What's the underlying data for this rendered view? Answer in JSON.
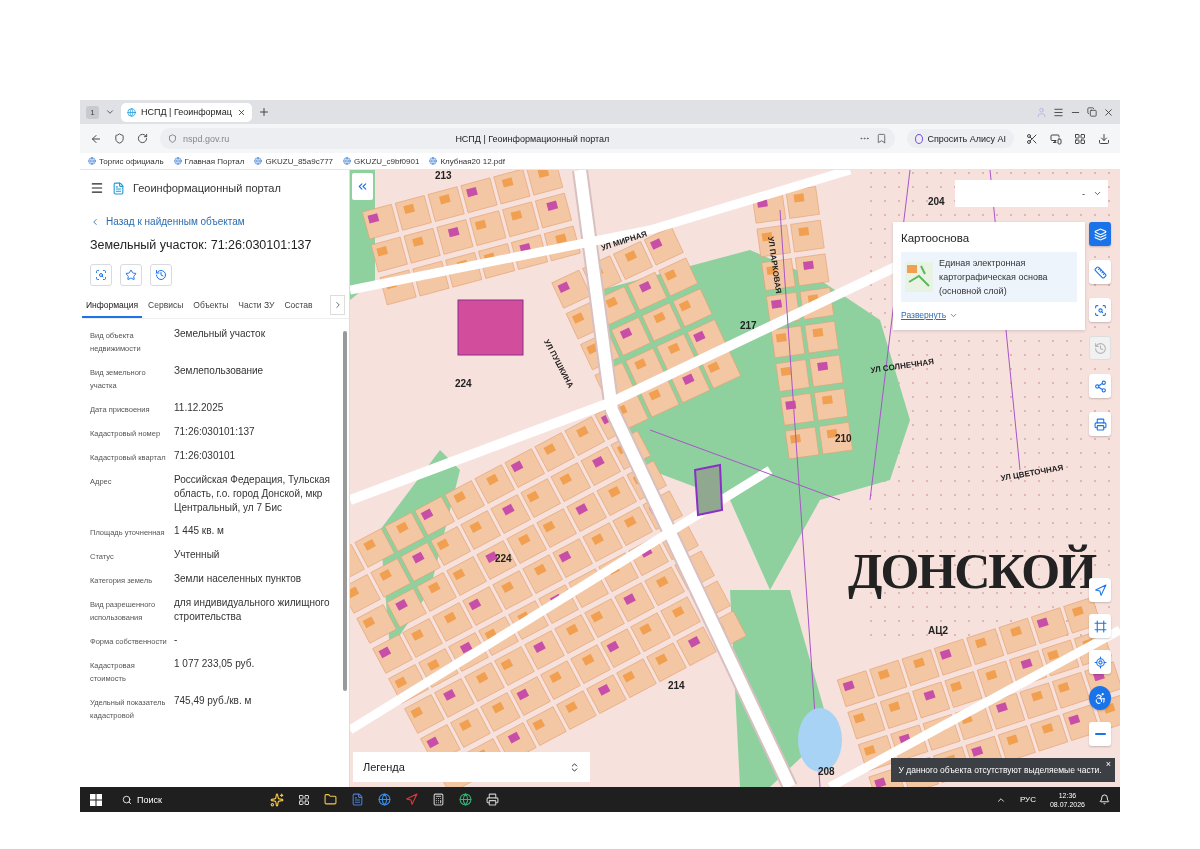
{
  "browser": {
    "tab_counter": "1",
    "tab_title": "НСПД | Геоинформац",
    "url": "nspd.gov.ru",
    "page_title": "НСПД | Геоинформационный портал",
    "ask_button": "Спросить Алису AI",
    "bookmarks": [
      "Торгис официаль",
      "Главная Портал",
      "GKUZU_85a9c777",
      "GKUZU_c9bf0901",
      "Клубная20 12.pdf"
    ]
  },
  "sidebar": {
    "app_title": "Геоинформационный портал",
    "back_link": "Назад к найденным объектам",
    "heading": "Земельный участок: 71:26:030101:137",
    "tabs": [
      {
        "label": "Информация",
        "selected": true
      },
      {
        "label": "Сервисы",
        "selected": false
      },
      {
        "label": "Объекты",
        "selected": false
      },
      {
        "label": "Части ЗУ",
        "selected": false
      },
      {
        "label": "Состав",
        "selected": false
      }
    ],
    "properties": [
      {
        "label": "Вид объекта недвижимости",
        "value": "Земельный участок"
      },
      {
        "label": "Вид земельного участка",
        "value": "Землепользование"
      },
      {
        "label": "Дата присвоения",
        "value": "11.12.2025"
      },
      {
        "label": "Кадастровый номер",
        "value": "71:26:030101:137"
      },
      {
        "label": "Кадастровый квартал",
        "value": "71:26:030101"
      },
      {
        "label": "Адрес",
        "value": "Российская Федерация, Тульская область, г.о. город Донской, мкр Центральный, ул 7 Бис"
      },
      {
        "label": "Площадь уточненная",
        "value": "1 445 кв. м"
      },
      {
        "label": "Статус",
        "value": "Учтенный"
      },
      {
        "label": "Категория земель",
        "value": "Земли населенных пунктов"
      },
      {
        "label": "Вид разрешенного использования",
        "value": "для индивидуального жилищного строительства"
      },
      {
        "label": "Форма собственности",
        "value": "-"
      },
      {
        "label": "Кадастровая стоимость",
        "value": "1 077 233,05 руб."
      },
      {
        "label": "Удельный показатель кадастровой",
        "value": "745,49 руб./кв. м"
      }
    ]
  },
  "map": {
    "layer_select": {
      "value": "-"
    },
    "basemap": {
      "title": "Картооснова",
      "layer": "Единая электронная картографическая основа (основной слой)",
      "expand_link": "Развернуть"
    },
    "tools": [
      {
        "kind": "layers",
        "selected": true,
        "disabled": false
      },
      {
        "kind": "ruler",
        "selected": false,
        "disabled": false
      },
      {
        "kind": "area-search",
        "selected": false,
        "disabled": false
      },
      {
        "kind": "history",
        "selected": false,
        "disabled": true
      },
      {
        "kind": "share",
        "selected": false,
        "disabled": false
      },
      {
        "kind": "print",
        "selected": false,
        "disabled": false
      }
    ],
    "nav_tools": [
      {
        "kind": "navigate"
      },
      {
        "kind": "frame"
      },
      {
        "kind": "locate"
      },
      {
        "kind": "accessibility"
      },
      {
        "kind": "zoom-out"
      }
    ],
    "labels": [
      {
        "kind": "number",
        "text": "213"
      },
      {
        "kind": "number",
        "text": "204"
      },
      {
        "kind": "street",
        "text": "УЛ МИРНАЯ"
      },
      {
        "kind": "street",
        "text": "УЛ ПАРКОВАЯ"
      },
      {
        "kind": "number",
        "text": "217"
      },
      {
        "kind": "number",
        "text": "224"
      },
      {
        "kind": "street",
        "text": "УЛ ПУШКИНА"
      },
      {
        "kind": "street",
        "text": "УЛ СОЛНЕЧНАЯ"
      },
      {
        "kind": "number",
        "text": "210"
      },
      {
        "kind": "street",
        "text": "УЛ ЦВЕТОЧНАЯ"
      },
      {
        "kind": "number",
        "text": "224"
      },
      {
        "kind": "town",
        "text": "ДОНСКОЙ"
      },
      {
        "kind": "number",
        "text": "АЦ2"
      },
      {
        "kind": "number",
        "text": "214"
      },
      {
        "kind": "number",
        "text": "208"
      }
    ],
    "legend": {
      "label": "Легенда"
    },
    "toast": {
      "text": "У данного объекта отсутствуют выделяемые части.",
      "close": "×"
    }
  },
  "taskbar": {
    "search": {
      "placeholder": "Поиск"
    },
    "language": "РУС",
    "time": "12:36",
    "date": "08.07.2026"
  }
}
